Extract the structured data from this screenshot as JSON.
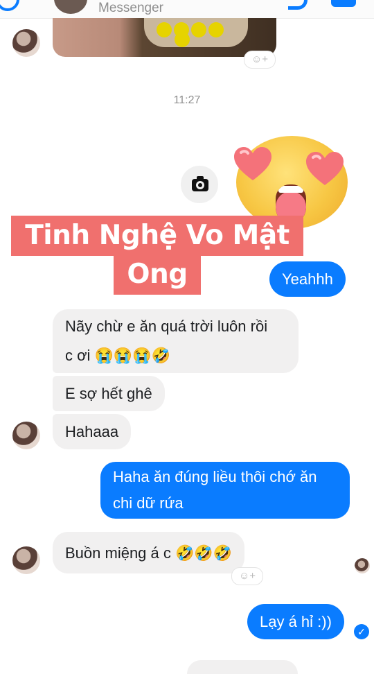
{
  "header": {
    "title": "Messenger"
  },
  "messages": {
    "time_label": "11:27",
    "sticker_line1": "Tinh Nghệ Vo Mật",
    "sticker_line2": "Ong",
    "out1": "Yeahhh",
    "in1_line1": "Nãy chừ e ăn quá trời luôn rồi",
    "in1_line2": "c ơi 😭😭😭🤣",
    "in2": "E sợ hết ghê",
    "in3": "Hahaaa",
    "out2_line1": "Haha ăn đúng liều thôi chớ ăn",
    "out2_line2": "chi dữ rứa",
    "in4": "Buồn miệng á c 🤣🤣🤣",
    "out3": "Lạy á hỉ :))",
    "reaction_add": "☺+",
    "delivered_mark": "✓"
  },
  "colors": {
    "outgoing": "#0a7cff",
    "incoming": "#f1f0f0",
    "sticker": "#f0706e"
  },
  "icons": [
    "back-icon",
    "call-icon",
    "video-icon",
    "camera-icon",
    "add-reaction-icon",
    "heart-eyes-emoji",
    "delivered-check-icon"
  ]
}
